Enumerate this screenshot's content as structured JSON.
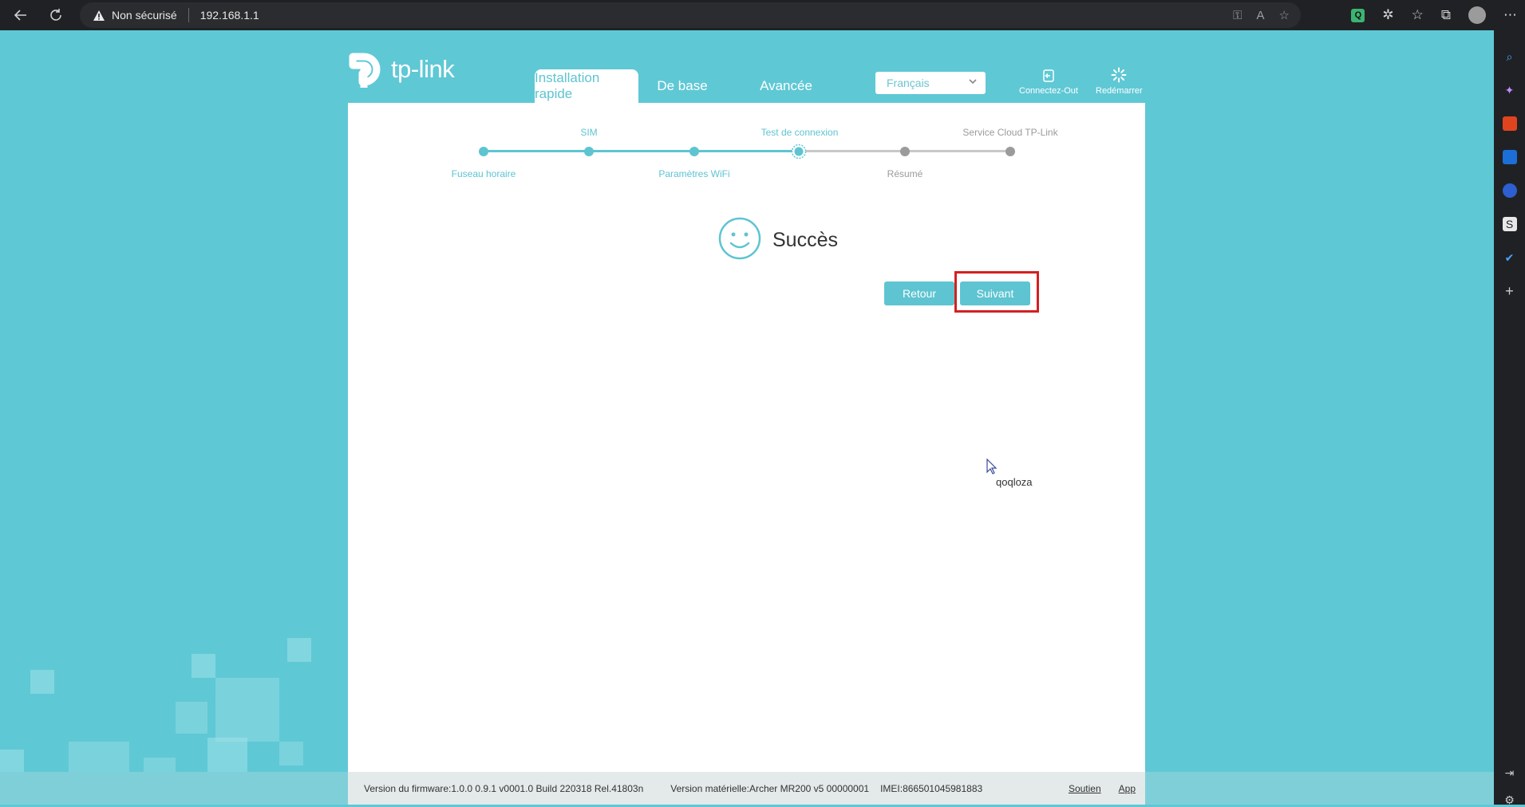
{
  "browser": {
    "security_label": "Non sécurisé",
    "url": "192.168.1.1",
    "icons": [
      "back-icon",
      "refresh-icon",
      "warning-icon",
      "key-icon",
      "read-aloud-icon",
      "favorite-add-icon",
      "extension-icon",
      "puzzle-icon",
      "favorites-icon",
      "collections-icon",
      "profile-icon",
      "more-icon"
    ]
  },
  "header": {
    "logo_text": "tp-link",
    "tabs": [
      {
        "label": "Installation rapide",
        "active": true
      },
      {
        "label": "De base",
        "active": false
      },
      {
        "label": "Avancée",
        "active": false
      }
    ],
    "language": "Français",
    "logout_label": "Connectez-Out",
    "reboot_label": "Redémarrer"
  },
  "wizard": {
    "steps": [
      {
        "label": "Fuseau horaire",
        "state": "done"
      },
      {
        "label": "SIM",
        "state": "done"
      },
      {
        "label": "Paramètres WiFi",
        "state": "done"
      },
      {
        "label": "Test de connexion",
        "state": "current"
      },
      {
        "label": "Résumé",
        "state": "todo"
      },
      {
        "label": "Service Cloud TP-Link",
        "state": "todo"
      }
    ]
  },
  "main": {
    "status_text": "Succès",
    "back_label": "Retour",
    "next_label": "Suivant",
    "cursor_label": "qoqloza"
  },
  "footer": {
    "firmware": "Version du firmware:1.0.0 0.9.1 v0001.0 Build 220318 Rel.41803n",
    "hardware": "Version matérielle:Archer MR200 v5 00000001",
    "imei": "IMEI:866501045981883",
    "support_link": "Soutien",
    "app_link": "App"
  },
  "colors": {
    "brand": "#5ec4d1",
    "background": "#5fc8d5",
    "highlight": "#d42020"
  }
}
